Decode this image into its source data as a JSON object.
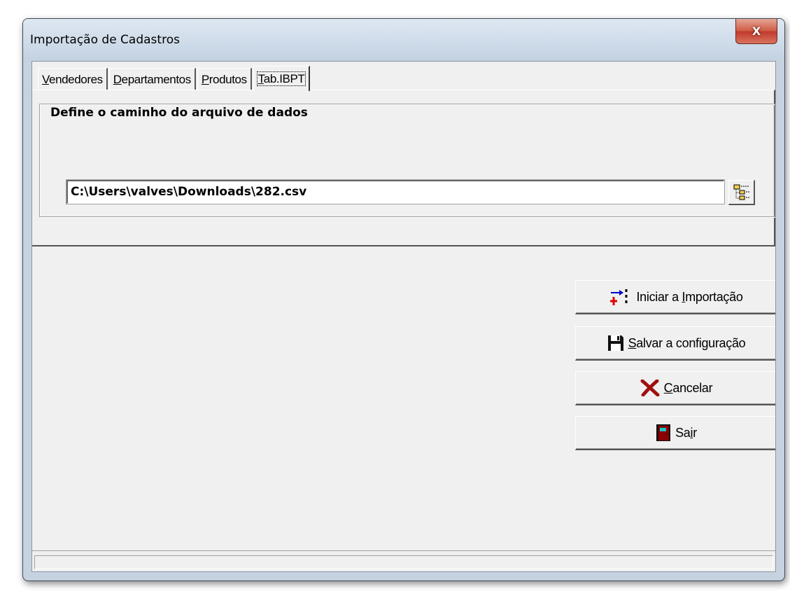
{
  "window": {
    "title": "Importação de Cadastros",
    "close_symbol": "X"
  },
  "tabs": [
    {
      "pre": "",
      "mnemonic": "V",
      "post": "endedores",
      "active": false
    },
    {
      "pre": "",
      "mnemonic": "D",
      "post": "epartamentos",
      "active": false
    },
    {
      "pre": "",
      "mnemonic": "P",
      "post": "rodutos",
      "active": false
    },
    {
      "pre": "",
      "mnemonic": "T",
      "post": "ab.IBPT",
      "active": true
    }
  ],
  "group": {
    "legend": "Define o caminho do arquivo de dados",
    "path_value": "C:\\Users\\valves\\Downloads\\282.csv"
  },
  "buttons": {
    "start": {
      "pre": "Iniciar a ",
      "mnemonic": "I",
      "post": "mportação",
      "icon": "import-arrows-icon"
    },
    "save": {
      "pre": "",
      "mnemonic": "S",
      "post": "alvar a configuração",
      "icon": "floppy-disk-icon"
    },
    "cancel": {
      "pre": "",
      "mnemonic": "C",
      "post": "ancelar",
      "icon": "red-x-icon"
    },
    "exit": {
      "pre": "Sa",
      "mnemonic": "i",
      "post": "r",
      "icon": "door-exit-icon"
    }
  },
  "colors": {
    "close_button": "#c0392b",
    "cancel_x": "#a01010",
    "door": "#8b0000"
  }
}
